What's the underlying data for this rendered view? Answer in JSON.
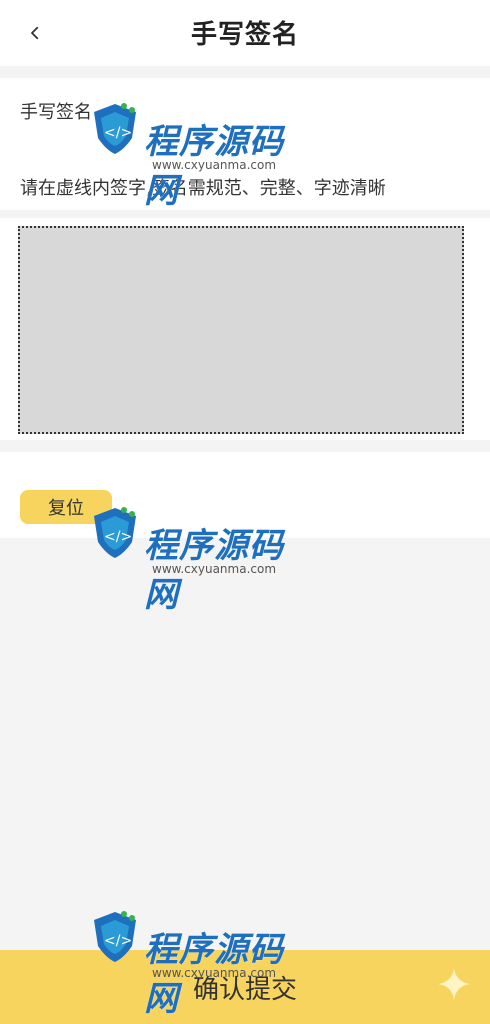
{
  "header": {
    "title": "手写签名",
    "back_icon": "chevron-left-icon"
  },
  "form": {
    "label": "手写签名",
    "instruction": "请在虚线内签字,签名需规范、完整、字迹清晰"
  },
  "pad": {
    "description": ""
  },
  "actions": {
    "reset_label": "复位",
    "submit_label": "确认提交"
  },
  "watermark": {
    "brand": "程序源码网",
    "url": "www.cxyuanma.com"
  },
  "colors": {
    "accent": "#f6d45e",
    "background": "#f4f4f4",
    "pad_fill": "#d8d8d8"
  }
}
